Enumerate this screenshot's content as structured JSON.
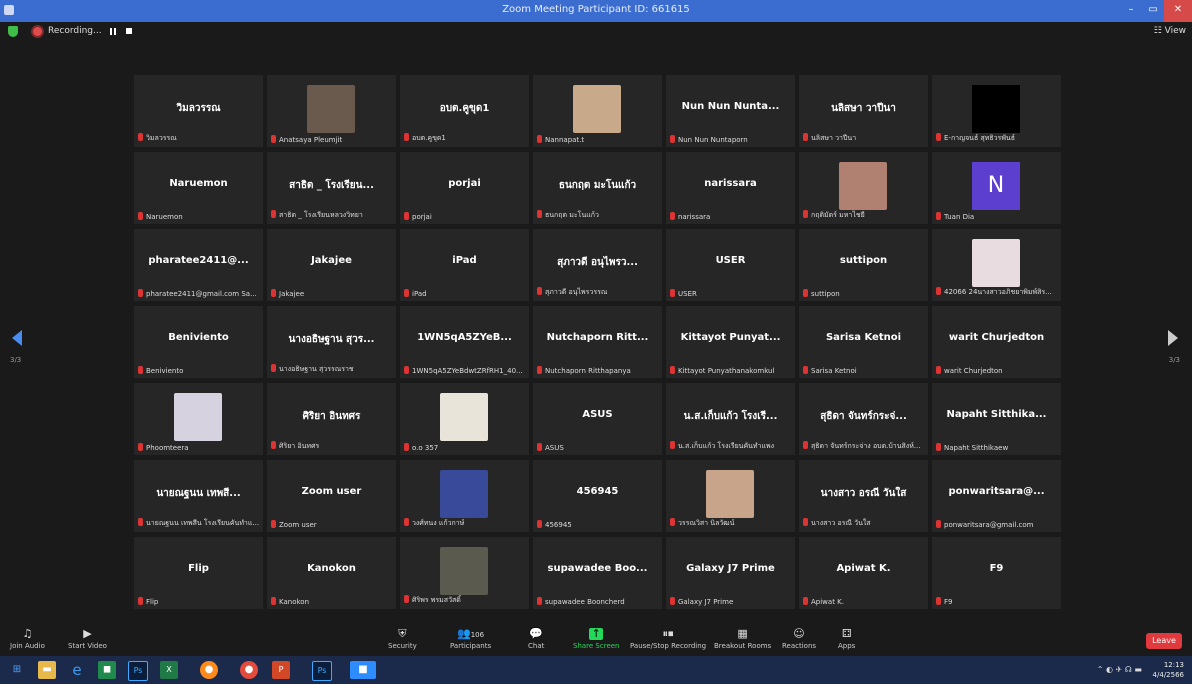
{
  "window": {
    "title": "Zoom Meeting Participant ID: 661615",
    "minimize": "–",
    "maximize": "▭",
    "close": "✕"
  },
  "topbar": {
    "recording_label": "Recording...",
    "view_label": "View"
  },
  "pagination": {
    "left": "3/3",
    "right": "3/3"
  },
  "tiles": [
    {
      "big": "วิมลวรรณ",
      "label": "วิมลวรรณ"
    },
    {
      "big": "",
      "label": "Anatsaya Pleumjit",
      "photo": "#6a5a4e"
    },
    {
      "big": "อบต.คูขุด1",
      "label": "อบต.คูขุด1"
    },
    {
      "big": "",
      "label": "Nannapat.t",
      "photo": "#c8a98a"
    },
    {
      "big": "Nun Nun Nunta...",
      "label": "Nun Nun Nuntaporn"
    },
    {
      "big": "นลิสษา วาปีนา",
      "label": "นลิสษา วาปีนา"
    },
    {
      "big": "",
      "label": "E-กาญจนธ์ สุทธิวรพันธ์",
      "black": true
    },
    {
      "big": "Naruemon",
      "label": "Naruemon"
    },
    {
      "big": "สาธิต _ โรงเรียน...",
      "label": "สาธิต _ โรงเรียนหลวงวิทยา"
    },
    {
      "big": "porjai",
      "label": "porjai"
    },
    {
      "big": "ธนกฤต มะโนแก้ว",
      "label": "ธนกฤต มะโนแก้ว"
    },
    {
      "big": "narissara",
      "label": "narissara"
    },
    {
      "big": "",
      "label": "กฤติมัตร์ มหาไชยี",
      "photo": "#b08070"
    },
    {
      "big": "",
      "label": "Tuan Dia",
      "avatar": "N"
    },
    {
      "big": "pharatee2411@...",
      "label": "pharatee2411@gmail.com Sa..."
    },
    {
      "big": "Jakajee",
      "label": "Jakajee"
    },
    {
      "big": "iPad",
      "label": "iPad"
    },
    {
      "big": "สุภาวดี อนุไพรว...",
      "label": "สุภาวดี อนุไพรวรรณ"
    },
    {
      "big": "USER",
      "label": "USER"
    },
    {
      "big": "suttipon",
      "label": "suttipon"
    },
    {
      "big": "",
      "label": "42066 24นางสาวอภิชยาพิมพ์สิร...",
      "photo": "#e8dce0"
    },
    {
      "big": "Beniviento",
      "label": "Beniviento"
    },
    {
      "big": "นางอธิษฐาน สุวร...",
      "label": "นางอธิษฐาน สุวรรณราช"
    },
    {
      "big": "1WN5qA5ZYeB...",
      "label": "1WN5qA5ZYeBdwtZRfRH1_40..."
    },
    {
      "big": "Nutchaporn Ritt...",
      "label": "Nutchaporn Ritthapanya"
    },
    {
      "big": "Kittayot Punyat...",
      "label": "Kittayot Punyathanakomkul"
    },
    {
      "big": "Sarisa Ketnoi",
      "label": "Sarisa Ketnoi"
    },
    {
      "big": "warit Churjedton",
      "label": "warit Churjedton"
    },
    {
      "big": "",
      "label": "Phoomteera",
      "photo": "#d7d2e0"
    },
    {
      "big": "ศิริยา อินทศร",
      "label": "ศิริยา อินทศร"
    },
    {
      "big": "",
      "label": "o.o 357",
      "photo": "#e9e4da"
    },
    {
      "big": "ASUS",
      "label": "ASUS"
    },
    {
      "big": "น.ส.เก็บแก้ว โรงเรี...",
      "label": "น.ส.เก็บแก้ว โรงเรียนคันทำแพง"
    },
    {
      "big": "สุธิดา จันทร์กระจ่...",
      "label": "สุธิดา จันทร์กระจ่าง อบต.บ้านสิงห์..."
    },
    {
      "big": "Napaht Sitthika...",
      "label": "Napaht Sitthikaew"
    },
    {
      "big": "นายณฐนน เทพสี...",
      "label": "นายณฐนน เทพสีน โรงเรียนคันทำแ..."
    },
    {
      "big": "Zoom user",
      "label": "Zoom user"
    },
    {
      "big": "",
      "label": "วงศ์ทนง แก้วกาษ์",
      "photo": "#3a4a9a"
    },
    {
      "big": "456945",
      "label": "456945"
    },
    {
      "big": "",
      "label": "วรรณวิสา นิลวัฒน์",
      "photo": "#c8a58a"
    },
    {
      "big": "นางสาว อรณี วันใส",
      "label": "นางสาว อรณี วันใส"
    },
    {
      "big": "ponwaritsara@...",
      "label": "ponwaritsara@gmail.com"
    },
    {
      "big": "Flip",
      "label": "Flip"
    },
    {
      "big": "Kanokon",
      "label": "Kanokon"
    },
    {
      "big": "",
      "label": "ศิริพร พรมสวัสดิ์",
      "photo": "#5a5a4e"
    },
    {
      "big": "supawadee Boo...",
      "label": "supawadee Booncherd"
    },
    {
      "big": "Galaxy J7 Prime",
      "label": "Galaxy J7 Prime"
    },
    {
      "big": "Apiwat K.",
      "label": "Apiwat K."
    },
    {
      "big": "F9",
      "label": "F9"
    }
  ],
  "toolbar": {
    "join_audio": "Join Audio",
    "start_video": "Start Video",
    "security": "Security",
    "participants": "Participants",
    "participants_count": "106",
    "chat": "Chat",
    "share_screen": "Share Screen",
    "pause_stop_recording": "Pause/Stop Recording",
    "breakout_rooms": "Breakout Rooms",
    "reactions": "Reactions",
    "apps": "Apps",
    "leave": "Leave"
  },
  "taskbar": {
    "time": "12:13",
    "date": "4/4/2566"
  },
  "colors": {
    "accent": "#3b6ccf",
    "leave": "#e0393e",
    "share": "#23d959",
    "mic_off": "#d33333"
  }
}
